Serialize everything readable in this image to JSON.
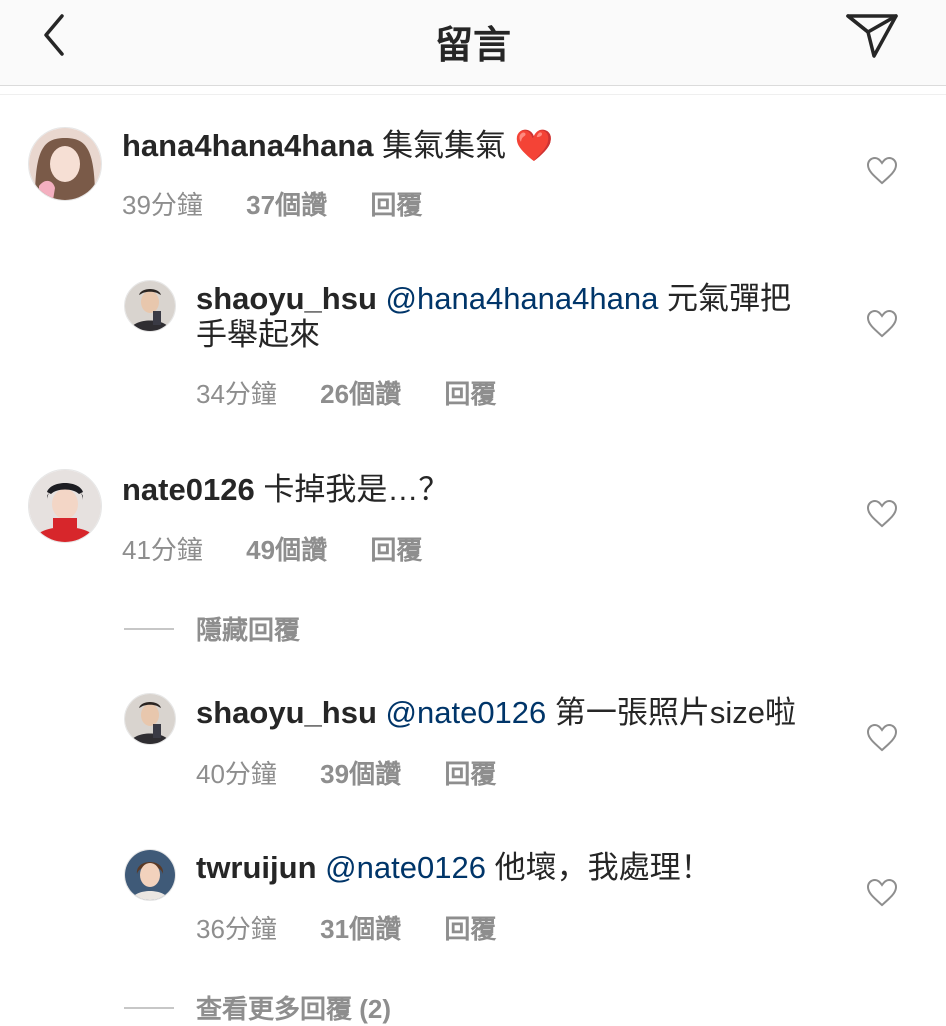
{
  "header": {
    "title": "留言"
  },
  "comments": [
    {
      "username": "hana4hana4hana",
      "text": "集氣集氣",
      "emoji": "❤️",
      "time": "39分鐘",
      "likes": "37個讚",
      "reply": "回覆"
    },
    {
      "username": "shaoyu_hsu",
      "mention": "@hana4hana4hana",
      "text": "元氣彈把",
      "text_line2": "手舉起來",
      "time": "34分鐘",
      "likes": "26個讚",
      "reply": "回覆"
    },
    {
      "username": "nate0126",
      "text": "卡掉我是…？",
      "time": "41分鐘",
      "likes": "49個讚",
      "reply": "回覆"
    },
    {
      "username": "shaoyu_hsu",
      "mention": "@nate0126",
      "text": "第一張照片size啦",
      "time": "40分鐘",
      "likes": "39個讚",
      "reply": "回覆"
    },
    {
      "username": "twruijun",
      "mention": "@nate0126",
      "text": "他壞，我處理！",
      "time": "36分鐘",
      "likes": "31個讚",
      "reply": "回覆"
    }
  ],
  "hide_replies_label": "隱藏回覆",
  "view_more_label": "查看更多回覆 (2)",
  "icons": {
    "back": "chevron-left-icon",
    "send": "paper-plane-icon",
    "like": "heart-outline-icon"
  },
  "colors": {
    "mention": "#003569",
    "meta": "#8e8e8e",
    "text": "#262626"
  }
}
